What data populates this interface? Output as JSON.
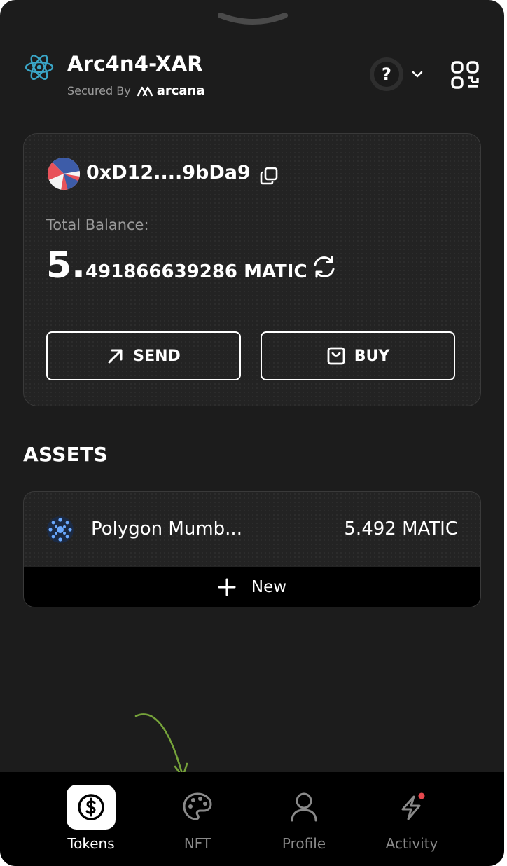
{
  "header": {
    "app_name": "Arc4n4-XAR",
    "secured_by": "Secured By",
    "brand": "arcana",
    "help_glyph": "?"
  },
  "wallet": {
    "address": "0xD12....9bDa9",
    "total_balance_label": "Total Balance:",
    "balance_integer": "5.",
    "balance_rest": "491866639286 MATIC",
    "send_label": "SEND",
    "buy_label": "BUY"
  },
  "assets": {
    "title": "ASSETS",
    "items": [
      {
        "name": "Polygon Mumb...",
        "amount": "5.492 MATIC"
      }
    ],
    "new_label": "New"
  },
  "nav": {
    "items": [
      {
        "label": "Tokens",
        "active": true
      },
      {
        "label": "NFT",
        "active": false
      },
      {
        "label": "Profile",
        "active": false
      },
      {
        "label": "Activity",
        "active": false
      }
    ]
  },
  "icons": {
    "logo": "atom-icon",
    "help": "question-icon",
    "dropdown": "chevron-down-icon",
    "qr": "qr-code-icon",
    "copy": "copy-icon",
    "refresh": "refresh-icon",
    "send": "arrow-up-right-icon",
    "buy": "wallet-icon",
    "add": "plus-icon",
    "tokens": "dollar-coin-icon",
    "nft": "palette-icon",
    "profile": "user-icon",
    "activity": "lightning-icon"
  },
  "colors": {
    "background": "#1c1c1c",
    "card": "#232323",
    "nav_background": "#000000",
    "accent_logo": "#3aa6c7",
    "notification_dot": "#e5484d",
    "annotation_arrow": "#76a33a"
  }
}
